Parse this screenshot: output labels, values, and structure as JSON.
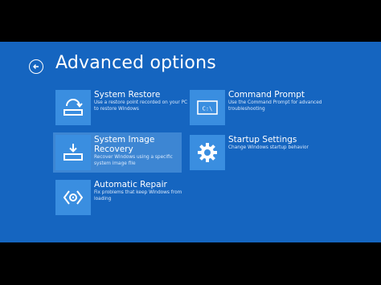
{
  "header": {
    "title": "Advanced options"
  },
  "options": [
    {
      "title": "System Restore",
      "description": "Use a restore point recorded on your PC to restore Windows",
      "icon": "system-restore-icon"
    },
    {
      "title": "Command Prompt",
      "description": "Use the Command Prompt for advanced troubleshooting",
      "icon": "command-prompt-icon",
      "icon_text": "C:\\"
    },
    {
      "title": "System Image Recovery",
      "description": "Recover Windows using a specific system image file",
      "icon": "system-image-recovery-icon"
    },
    {
      "title": "Startup Settings",
      "description": "Change Windows startup behavior",
      "icon": "gear-icon"
    },
    {
      "title": "Automatic Repair",
      "description": "Fix problems that keep Windows from loading",
      "icon": "automatic-repair-icon"
    }
  ],
  "colors": {
    "background": "#1565c0",
    "tile": "#3a8ee0",
    "selected": "#3d86d3",
    "letterbox": "#000000"
  }
}
